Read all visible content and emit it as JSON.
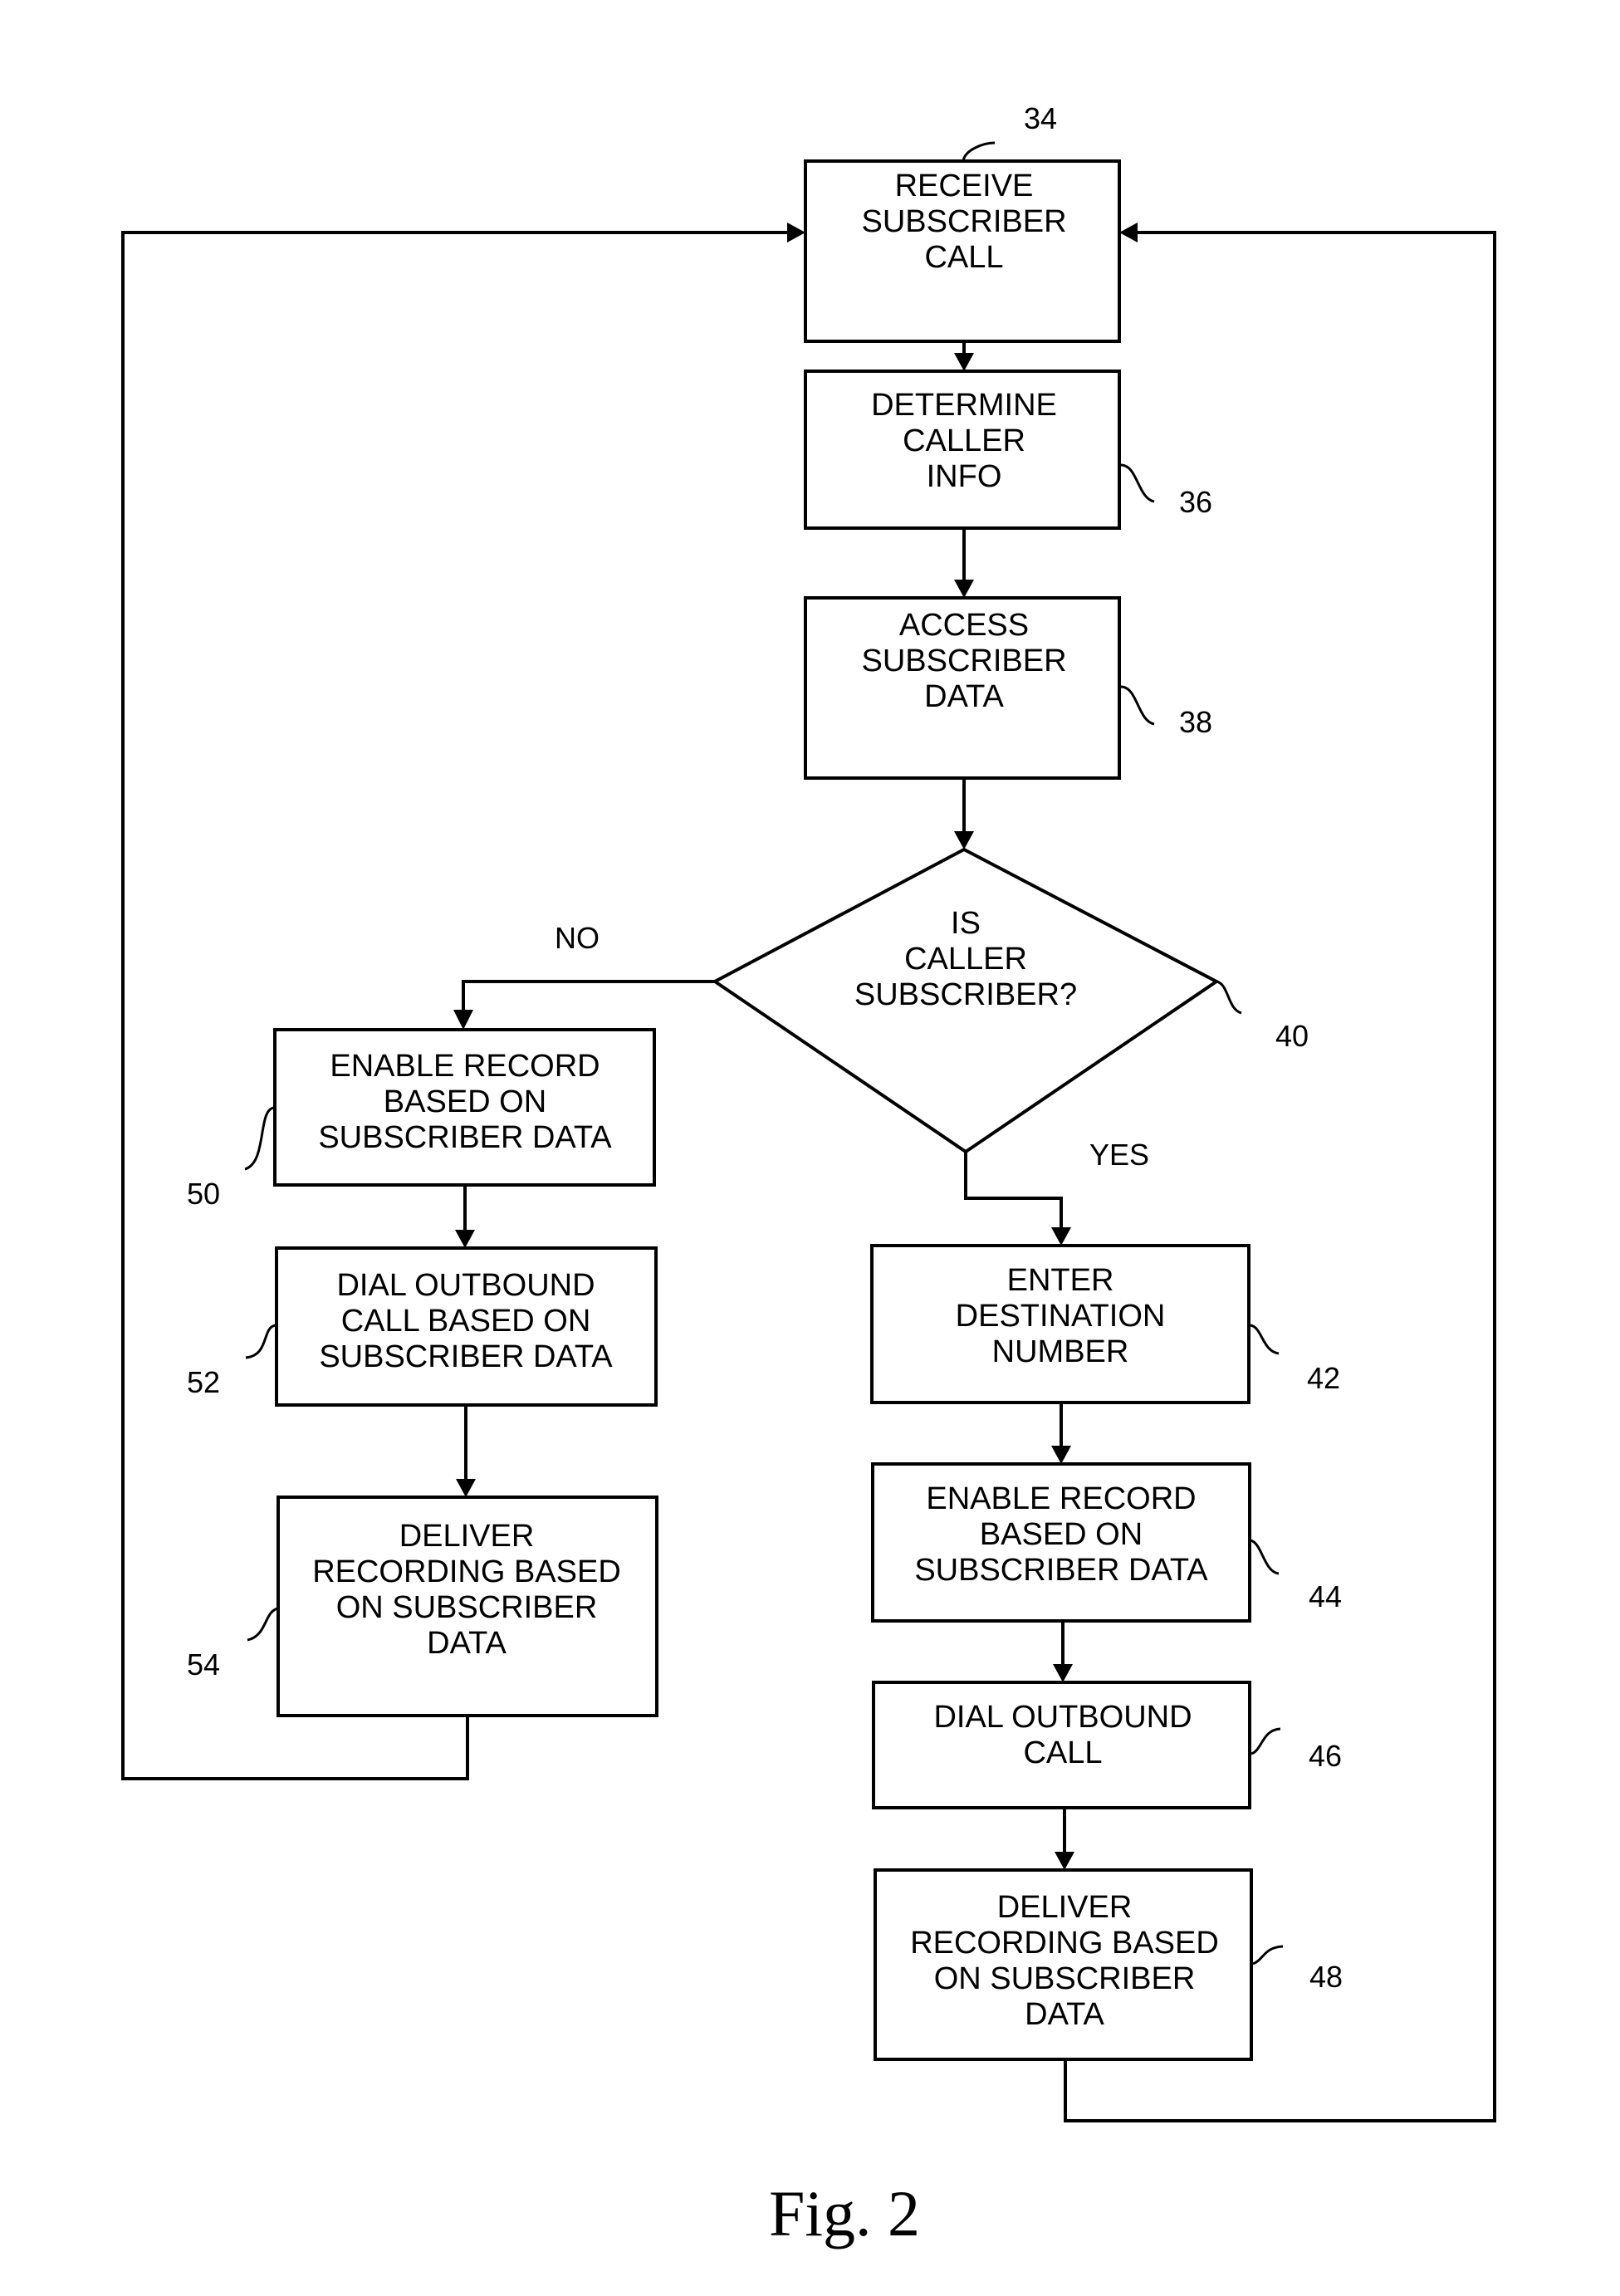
{
  "figure": {
    "caption": "Fig. 2",
    "type": "flowchart"
  },
  "nodes": [
    {
      "id": "34",
      "shape": "process",
      "lines": [
        "RECEIVE",
        "SUBSCRIBER",
        "CALL"
      ]
    },
    {
      "id": "36",
      "shape": "process",
      "lines": [
        "DETERMINE",
        "CALLER",
        "INFO"
      ]
    },
    {
      "id": "38",
      "shape": "process",
      "lines": [
        "ACCESS",
        "SUBSCRIBER",
        "DATA"
      ]
    },
    {
      "id": "40",
      "shape": "decision",
      "lines": [
        "IS",
        "CALLER",
        "SUBSCRIBER?"
      ]
    },
    {
      "id": "42",
      "shape": "process",
      "lines": [
        "ENTER",
        "DESTINATION",
        "NUMBER"
      ]
    },
    {
      "id": "44",
      "shape": "process",
      "lines": [
        "ENABLE RECORD",
        "BASED ON",
        "SUBSCRIBER DATA"
      ]
    },
    {
      "id": "46",
      "shape": "process",
      "lines": [
        "DIAL OUTBOUND",
        "CALL"
      ]
    },
    {
      "id": "48",
      "shape": "process",
      "lines": [
        "DELIVER",
        "RECORDING BASED",
        "ON SUBSCRIBER",
        "DATA"
      ]
    },
    {
      "id": "50",
      "shape": "process",
      "lines": [
        "ENABLE RECORD",
        "BASED ON",
        "SUBSCRIBER DATA"
      ]
    },
    {
      "id": "52",
      "shape": "process",
      "lines": [
        "DIAL OUTBOUND",
        "CALL BASED ON",
        "SUBSCRIBER DATA"
      ]
    },
    {
      "id": "54",
      "shape": "process",
      "lines": [
        "DELIVER",
        "RECORDING BASED",
        "ON SUBSCRIBER",
        "DATA"
      ]
    }
  ],
  "branches": {
    "no_label": "NO",
    "yes_label": "YES"
  },
  "edges": [
    {
      "from": "34",
      "to": "36"
    },
    {
      "from": "36",
      "to": "38"
    },
    {
      "from": "38",
      "to": "40"
    },
    {
      "from": "40",
      "to": "50",
      "label": "NO"
    },
    {
      "from": "40",
      "to": "42",
      "label": "YES"
    },
    {
      "from": "42",
      "to": "44"
    },
    {
      "from": "44",
      "to": "46"
    },
    {
      "from": "46",
      "to": "48"
    },
    {
      "from": "48",
      "to": "34"
    },
    {
      "from": "50",
      "to": "52"
    },
    {
      "from": "52",
      "to": "54"
    },
    {
      "from": "54",
      "to": "34"
    }
  ]
}
